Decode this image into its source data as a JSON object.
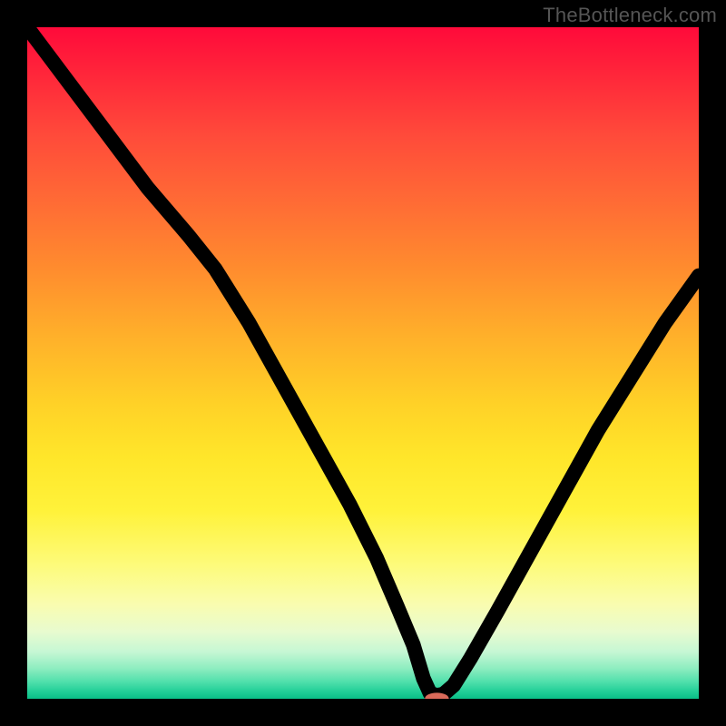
{
  "watermark": "TheBottleneck.com",
  "colors": {
    "background": "#000000",
    "curve": "#000000",
    "marker": "#d96a5a"
  },
  "chart_data": {
    "type": "line",
    "title": "",
    "xlabel": "",
    "ylabel": "",
    "xlim": [
      0,
      100
    ],
    "ylim": [
      0,
      100
    ],
    "grid": false,
    "legend": false,
    "marker": {
      "x": 61,
      "y": 0,
      "rx": 1.8,
      "ry": 0.9
    },
    "series": [
      {
        "name": "bottleneck-curve",
        "x": [
          0,
          6,
          12,
          18,
          24,
          28,
          33,
          38,
          43,
          48,
          52,
          55,
          57.5,
          59,
          60,
          61,
          62,
          63.5,
          66,
          70,
          75,
          80,
          85,
          90,
          95,
          100
        ],
        "y": [
          100,
          92,
          84,
          76,
          69,
          64,
          56,
          47,
          38,
          29,
          21,
          14,
          8,
          3,
          0.8,
          0.5,
          0.7,
          2,
          6,
          13,
          22,
          31,
          40,
          48,
          56,
          63
        ]
      }
    ]
  }
}
